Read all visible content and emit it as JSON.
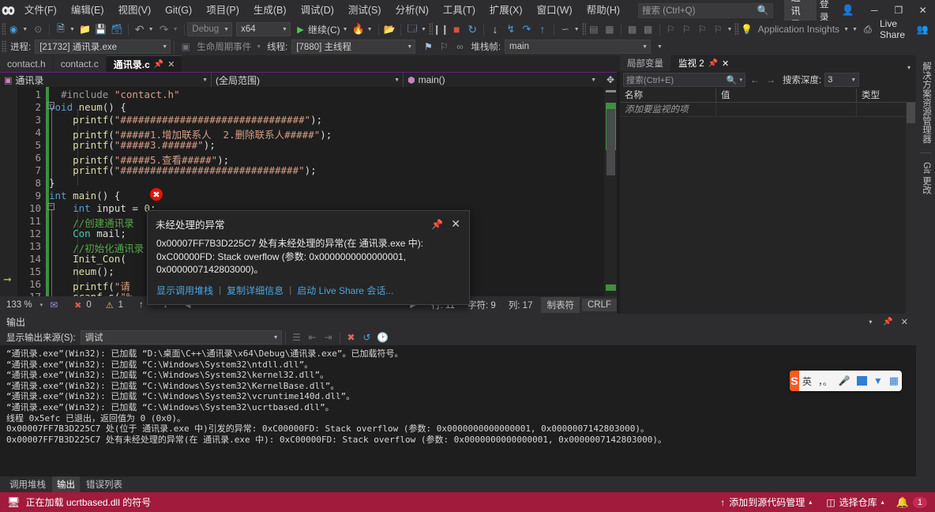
{
  "titlebar": {
    "logo_icon": "visual-studio-icon",
    "menus": [
      {
        "label": "文件(F)",
        "key": "F"
      },
      {
        "label": "编辑(E)",
        "key": "E"
      },
      {
        "label": "视图(V)",
        "key": "V"
      },
      {
        "label": "Git(G)",
        "key": "G"
      },
      {
        "label": "项目(P)",
        "key": "P"
      },
      {
        "label": "生成(B)",
        "key": "B"
      },
      {
        "label": "调试(D)",
        "key": "D"
      },
      {
        "label": "测试(S)",
        "key": "S"
      },
      {
        "label": "分析(N)",
        "key": "N"
      },
      {
        "label": "工具(T)",
        "key": "T"
      },
      {
        "label": "扩展(X)",
        "key": "X"
      },
      {
        "label": "窗口(W)",
        "key": "W"
      },
      {
        "label": "帮助(H)",
        "key": "H"
      }
    ],
    "search_placeholder": "搜索 (Ctrl+Q)",
    "search_icon": "search-icon",
    "solution_chip": "通讯录",
    "signin_label": "登录",
    "signin_icon": "account-icon",
    "minimize_icon": "─",
    "maximize_icon": "❐",
    "close_icon": "✕"
  },
  "toolbar_main": {
    "back_icon": "navigate-back-icon",
    "forward_icon": "navigate-forward-icon",
    "new_project_icon": "new-project-icon",
    "open_icon": "open-file-icon",
    "save_icon": "save-icon",
    "save_all_icon": "save-all-icon",
    "undo_icon": "undo-icon",
    "redo_icon": "redo-icon",
    "config_value": "Debug",
    "platform_value": "x64",
    "continue_label": "继续(C)",
    "continue_icon": "play-icon",
    "hotreload_icon": "hot-reload-icon",
    "attach_icon": "attach-process-icon",
    "layout_icon": "window-layout-icon",
    "pause_icon": "pause-icon",
    "stop_icon": "stop-icon",
    "restart_icon": "restart-icon",
    "step_into_icon": "step-into-icon",
    "step_over_icon": "step-over-icon",
    "step_out_icon": "step-out-icon",
    "step_up_icon": "step-up-icon",
    "diagnostics_icon": "diagnostics-icon",
    "app_insights_label": "Application Insights",
    "app_insights_icon": "lightbulb-icon",
    "live_share_label": "Live Share",
    "live_share_icon": "live-share-icon",
    "live_share_account_icon": "live-share-account-icon"
  },
  "toolbar_debug": {
    "process_label": "进程:",
    "process_value": "[21732] 通讯录.exe",
    "lifecycle_label": "生命周期事件",
    "lifecycle_icon": "lifecycle-icon",
    "thread_label": "线程:",
    "thread_value": "[7880] 主线程",
    "flag_icon": "flag-icon",
    "flags_icon": "flags-icon",
    "link_icon": "link-icon",
    "stackframe_label": "堆栈帧:",
    "stackframe_value": "main",
    "overflow_icon": "overflow-icon"
  },
  "editor_tabs": {
    "tabs": [
      {
        "label": "contact.h",
        "active": false
      },
      {
        "label": "contact.c",
        "active": false
      },
      {
        "label": "通讯录.c",
        "active": true
      }
    ],
    "pin_icon": "pin-icon",
    "close_icon": "✕",
    "chevron_icon": "▾",
    "gear_icon": "⚙"
  },
  "editor_nav": {
    "project_value": "通讯录",
    "project_icon": "project-icon",
    "scope_value": "(全局范围)",
    "member_value": "main()",
    "member_icon": "method-icon",
    "split_icon": "split-view-icon"
  },
  "code": {
    "lines": [
      {
        "n": 1,
        "html": "  <span class='pp'>#include</span> <span class='str'>\"contact.h\"</span>"
      },
      {
        "n": 2,
        "html": "<span class='kw'>void</span> <span class='fn'>neum</span><span class='pun'>() {</span>",
        "fold": true
      },
      {
        "n": 3,
        "html": "    <span class='fn'>printf</span><span class='pun'>(</span><span class='str'>\"###############################\"</span><span class='pun'>);</span>"
      },
      {
        "n": 4,
        "html": "    <span class='fn'>printf</span><span class='pun'>(</span><span class='str'>\"#####1.增加联系人  2.删除联系人#####\"</span><span class='pun'>);</span>"
      },
      {
        "n": 5,
        "html": "    <span class='fn'>printf</span><span class='pun'>(</span><span class='str'>\"#####3.######\"</span><span class='pun'>);</span>"
      },
      {
        "n": 6,
        "html": "    <span class='fn'>printf</span><span class='pun'>(</span><span class='str'>\"#####5.查看#####\"</span><span class='pun'>);</span>"
      },
      {
        "n": 7,
        "html": "    <span class='fn'>printf</span><span class='pun'>(</span><span class='str'>\"##############################\"</span><span class='pun'>);</span>"
      },
      {
        "n": 8,
        "html": "<span class='pun'>}</span>"
      },
      {
        "n": 9,
        "html": "<span class='kw'>int</span> <span class='fn'>main</span><span class='pun'>() {</span>",
        "fold": true
      },
      {
        "n": 10,
        "html": "    <span class='kw'>int</span> input <span class='pun'>=</span> <span class='num'>0</span><span class='pun'>;</span>"
      },
      {
        "n": 11,
        "html": "    <span class='cmt'>//创建通讯录</span>"
      },
      {
        "n": 12,
        "html": "    <span class='typ'>Con</span> mail<span class='pun'>;</span>"
      },
      {
        "n": 13,
        "html": "    <span class='cmt'>//初始化通讯录</span>"
      },
      {
        "n": 14,
        "html": "    <span class='fn'>Init_Con</span><span class='pun'>(</span>"
      },
      {
        "n": 15,
        "html": "    <span class='fn'>neum</span><span class='pun'>();</span>"
      },
      {
        "n": 16,
        "html": "    <span class='fn'>printf</span><span class='pun'>(</span><span class='str'>\"请</span>"
      },
      {
        "n": 17,
        "html": "    <span class='fn'>scanf_s</span><span class='pun'>(</span><span class='str'>\"%</span>"
      }
    ],
    "current_line": 11,
    "execution_arrow_line": 9
  },
  "exception_dialog": {
    "title": "未经处理的异常",
    "pin_icon": "pin-icon",
    "close_icon": "✕",
    "badge_icon": "✖",
    "message_line1": "0x00007FF7B3D225C7 处有未经处理的异常(在 通讯录.exe 中):",
    "message_line2": "0xC00000FD: Stack overflow (参数: 0x0000000000000001,",
    "message_line3": "0x0000007142803000)。",
    "links": [
      "显示调用堆栈",
      "复制详细信息",
      "启动 Live Share 会话..."
    ]
  },
  "editor_status": {
    "zoom": "133 %",
    "zoom_caret": "▾",
    "feedback_icon": "feedback-icon",
    "error_icon": "error-icon",
    "error_count": "0",
    "warning_icon": "warning-icon",
    "warning_count": "1",
    "prev_icon": "↑",
    "next_icon": "↓",
    "scroll_left_icon": "◀",
    "scroll_right_icon": "▶",
    "line_label": "行: 11",
    "char_label": "字符: 9",
    "col_label": "列: 17",
    "tabs_label": "制表符",
    "eol_label": "CRLF"
  },
  "output_pane": {
    "title": "输出",
    "source_label": "显示输出来源(S):",
    "source_value": "调试",
    "toolbar_icons": [
      "find-message-icon",
      "collapse-icon",
      "expand-icon",
      "clear-all-icon",
      "word-wrap-icon",
      "timestamp-icon"
    ],
    "pin_icon": "pin-icon",
    "close_icon": "✕",
    "chevron_icon": "▾",
    "lines": [
      "“通讯录.exe”(Win32): 已加载 “D:\\桌面\\C++\\通讯录\\x64\\Debug\\通讯录.exe”。已加载符号。",
      "“通讯录.exe”(Win32): 已加载 “C:\\Windows\\System32\\ntdll.dll”。",
      "“通讯录.exe”(Win32): 已加载 “C:\\Windows\\System32\\kernel32.dll”。",
      "“通讯录.exe”(Win32): 已加载 “C:\\Windows\\System32\\KernelBase.dll”。",
      "“通讯录.exe”(Win32): 已加载 “C:\\Windows\\System32\\vcruntime140d.dll”。",
      "“通讯录.exe”(Win32): 已加载 “C:\\Windows\\System32\\ucrtbased.dll”。",
      "线程 0x5efc 已退出，返回值为 0 (0x0)。",
      "0x00007FF7B3D225C7 处(位于 通讯录.exe 中)引发的异常: 0xC00000FD: Stack overflow (参数: 0x0000000000000001, 0x0000007142803000)。",
      "0x00007FF7B3D225C7 处有未经处理的异常(在 通讯录.exe 中): 0xC00000FD: Stack overflow (参数: 0x0000000000000001, 0x0000007142803000)。"
    ]
  },
  "watch_pane": {
    "tabs": [
      {
        "label": "局部变量",
        "active": false
      },
      {
        "label": "监视 2",
        "active": true
      }
    ],
    "pin_icon": "pin-icon",
    "close_icon": "✕",
    "chevron_icon": "▾",
    "search_placeholder": "搜索(Ctrl+E)",
    "search_icon": "search-icon",
    "search_caret": "▾",
    "prev_icon": "←",
    "next_icon": "→",
    "depth_label": "搜索深度:",
    "depth_value": "3",
    "columns": [
      "名称",
      "值",
      "类型"
    ],
    "rows": [
      {
        "name": "添加要监视的项",
        "value": "",
        "type": ""
      }
    ]
  },
  "vertical_tabs": [
    "解决方案资源管理器",
    "Git 更改"
  ],
  "bottom_tabs": [
    {
      "label": "调用堆栈",
      "active": false
    },
    {
      "label": "输出",
      "active": true
    },
    {
      "label": "错误列表",
      "active": false
    }
  ],
  "statusbar": {
    "icon": "symbol-loading-icon",
    "message": "正在加载 ucrtbased.dll 的符号",
    "add_to_source_label": "添加到源代码管理",
    "add_to_source_icon": "↑",
    "add_to_source_caret": "▴",
    "repo_label": "选择仓库",
    "repo_icon": "repository-icon",
    "repo_caret": "▴",
    "bell_icon": "bell-icon",
    "bell_count": "1",
    "accent_color": "#a01b3c"
  },
  "ime": {
    "logo_text": "S",
    "mode_label": "英",
    "punctuation_icon": "，。",
    "mic_icon": "mic-icon",
    "keyboard_icon": "keyboard-icon",
    "toolbox_icon": "toolbox-icon",
    "grid_icon": "app-grid-icon"
  }
}
